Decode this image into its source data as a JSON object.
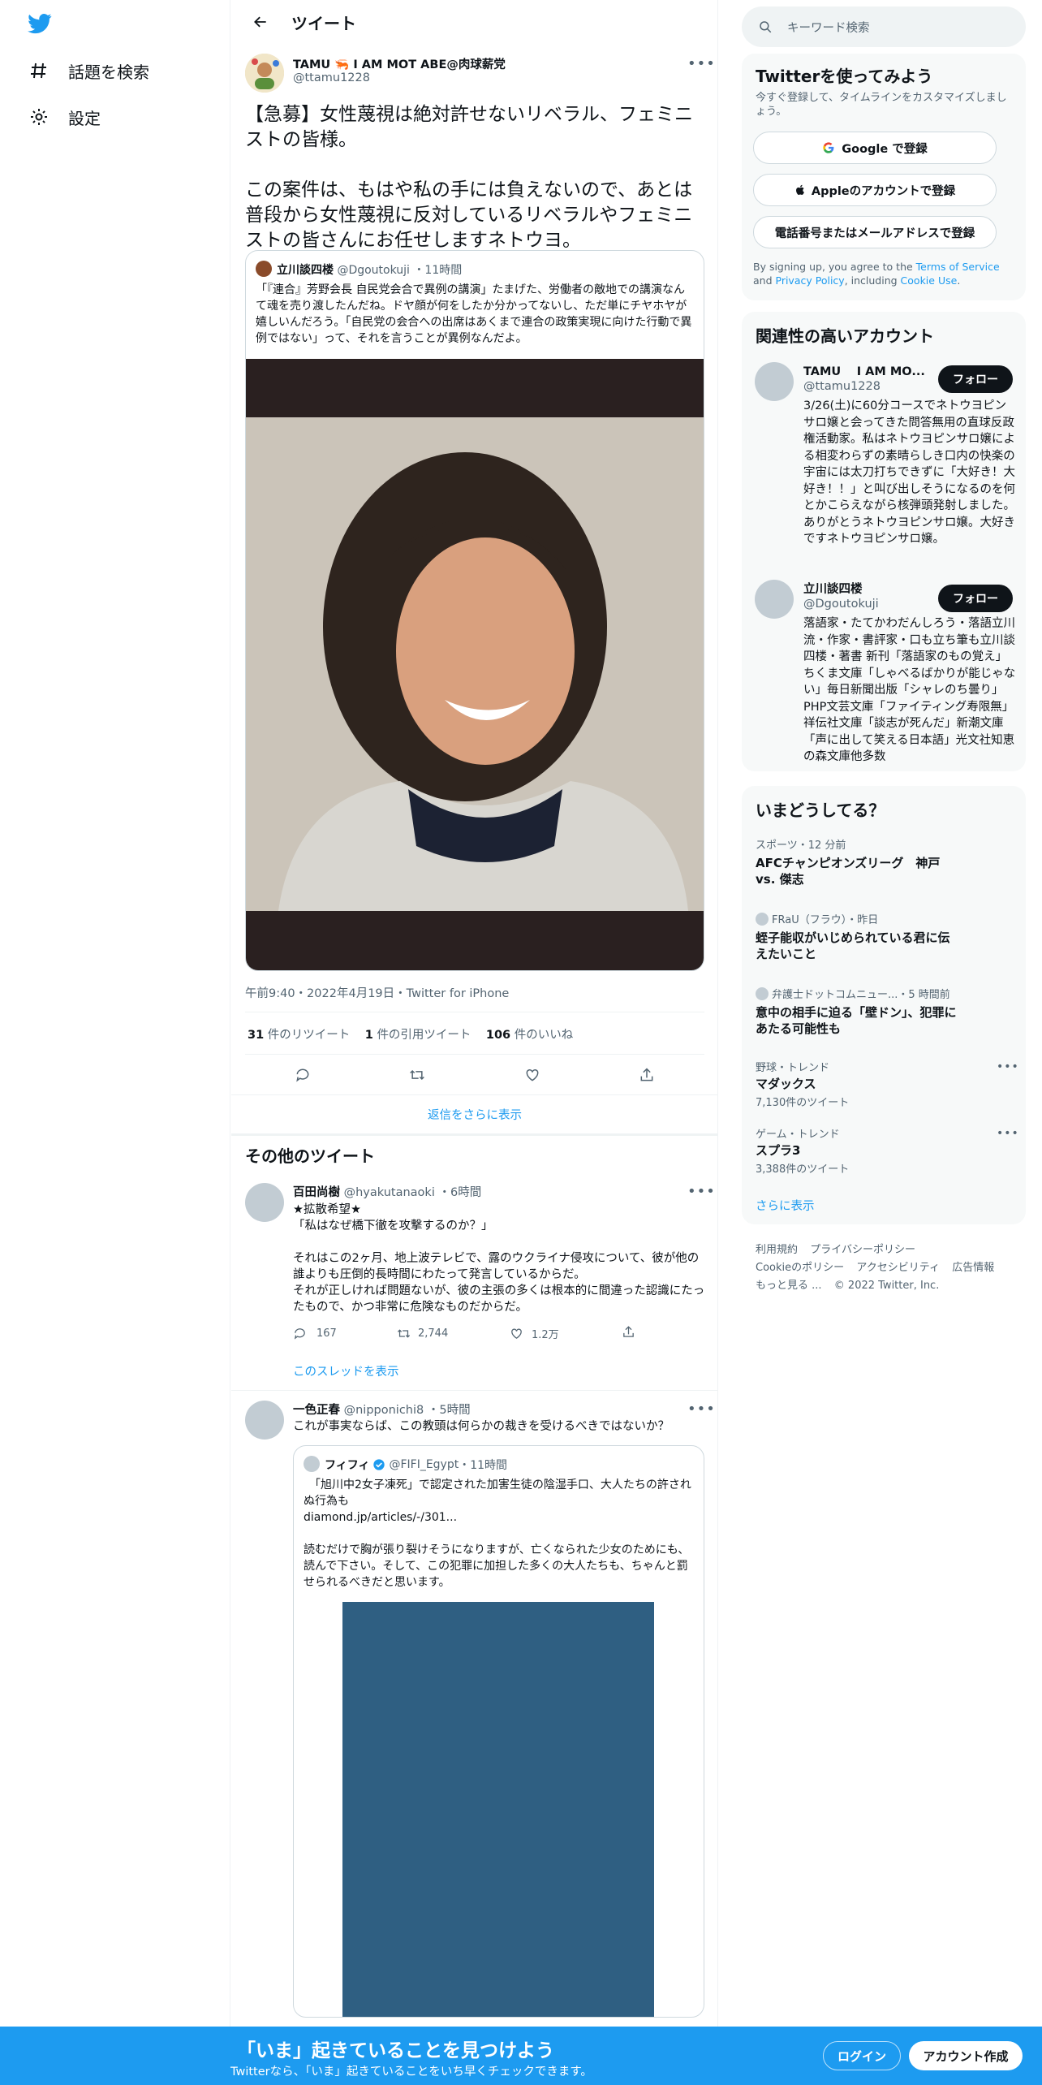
{
  "nav": {
    "logo": "twitter-bird",
    "items": [
      {
        "label": "話題を検索",
        "icon": "hashtag-icon"
      },
      {
        "label": "設定",
        "icon": "gear-icon"
      }
    ]
  },
  "header": {
    "title": "ツイート"
  },
  "tweet": {
    "name": "TAMU 🦐 I AM MOT ABE@肉球薪党",
    "handle": "@ttamu1228",
    "text": "【急募】女性蔑視は絶対許せないリベラル、フェミニストの皆様。\n\nこの案件は、もはや私の手には負えないので、あとは普段から女性蔑視に反対しているリベラルやフェミニストの皆さんにお任せしますネトウヨ。",
    "quote": {
      "name": "立川談四楼",
      "handle": "@Dgoutokuji",
      "time": "11時間",
      "text": "「『連合』芳野会長 自民党会合で異例の講演」たまげた、労働者の敵地での講演なんて魂を売り渡したんだね。ドヤ顔が何をしたか分かってないし、ただ単にチヤホヤが嬉しいんだろう。「自民党の会合への出席はあくまで連合の政策実現に向けた行動で異例ではない」って、それを言うことが異例なんだよ。"
    },
    "meta": "午前9:40・2022年4月19日・Twitter for iPhone",
    "stats": {
      "retweets_n": "31",
      "retweets_l": "件のリツイート",
      "quotes_n": "1",
      "quotes_l": "件の引用ツイート",
      "likes_n": "106",
      "likes_l": "件のいいね"
    },
    "show_more": "返信をさらに表示"
  },
  "other": {
    "heading": "その他のツイート",
    "t1": {
      "name": "百田尚樹",
      "handle": "@hyakutanaoki",
      "time": "6時間",
      "text": "★拡散希望★\n「私はなぜ橋下徹を攻撃するのか？」\n\nそれはこの2ヶ月、地上波テレビで、露のウクライナ侵攻について、彼が他の誰よりも圧倒的長時間にわたって発言しているからだ。\nそれが正しければ問題ないが、彼の主張の多くは根本的に間違った認識にたったもので、かつ非常に危険なものだからだ。",
      "replies": "167",
      "retweets": "2,744",
      "likes": "1.2万",
      "thread": "このスレッドを表示"
    },
    "t2": {
      "name": "一色正春",
      "handle": "@nipponichi8",
      "time": "5時間",
      "text": "これが事実ならば、この教頭は何らかの裁きを受けるべきではないか？",
      "quote": {
        "name": "フィフィ",
        "handle": "@FIFI_Egypt",
        "time": "11時間",
        "text": "　「旭川中2女子凍死」で認定された加害生徒の陰湿手口、大人たちの許されぬ行為も\ndiamond.jp/articles/-/301...\n\n読むだけで胸が張り裂けそうになりますが、亡くなられた少女のためにも、読んで下さい。そして、この犯罪に加担した多くの大人たちも、ちゃんと罰せられるべきだと思います。"
      }
    }
  },
  "sidebar": {
    "search_placeholder": "キーワード検索",
    "signup": {
      "title": "Twitterを使ってみよう",
      "sub": "今すぐ登録して、タイムラインをカスタマイズしましょう。",
      "google": "Google で登録",
      "apple": "Appleのアカウントで登録",
      "phone": "電話番号またはメールアドレスで登録",
      "terms_pre": "By signing up, you agree to the ",
      "terms": "Terms of Service",
      "and": " and ",
      "privacy": "Privacy Policy",
      "incl": ", including ",
      "cookie": "Cookie Use",
      "dot": "."
    },
    "related": {
      "title": "関連性の高いアカウント",
      "follow": "フォロー",
      "accounts": [
        {
          "name": "TAMU　 I AM MO...",
          "handle": "@ttamu1228",
          "desc": "3/26(土)に60分コースでネトウヨピンサロ嬢と会ってきた問答無用の直球反政権活動家。私はネトウヨピンサロ嬢による相変わらずの素晴らしき口内の快楽の宇宙には太刀打ちできずに「大好き！大好き！！」と叫び出しそうになるのを何とかこらえながら核弾頭発射しました。ありがとうネトウヨピンサロ嬢。大好きですネトウヨピンサロ嬢。"
        },
        {
          "name": "立川談四楼",
          "handle": "@Dgoutokuji",
          "desc": "落語家・たてかわだんしろう・落語立川流・作家・書評家・口も立ち筆も立川談四楼・著書 新刊「落語家のもの覚え」ちくま文庫「しゃべるばかりが能じゃない」毎日新聞出版「シャレのち曇り」PHP文芸文庫「ファイティング寿限無」祥伝社文庫「談志が死んだ」新潮文庫「声に出して笑える日本語」光文社知恵の森文庫他多数"
        }
      ]
    },
    "trends": {
      "title": "いまどうしてる？",
      "items": [
        {
          "cat": "スポーツ・12 分前",
          "title": "AFCチャンピオンズリーグ　神戸 vs. 傑志"
        },
        {
          "cat": "FRaU（フラウ）・昨日",
          "title": "蛭子能収がいじめられている君に伝えたいこと"
        },
        {
          "cat": "弁護士ドットコムニュー...・5 時間前",
          "title": "意中の相手に迫る「壁ドン」、犯罪にあたる可能性も"
        },
        {
          "cat": "野球・トレンド",
          "title": "マダックス",
          "count": "7,130件のツイート"
        },
        {
          "cat": "ゲーム・トレンド",
          "title": "スプラ3",
          "count": "3,388件のツイート"
        }
      ],
      "more": "さらに表示"
    },
    "footer": {
      "terms": "利用規約",
      "privacy": "プライバシーポリシー",
      "cookie": "Cookieのポリシー",
      "access": "アクセシビリティ",
      "ads": "広告情報",
      "more": "もっと見る ...",
      "copy": "© 2022 Twitter, Inc."
    }
  },
  "bottom": {
    "title": "「いま」起きていることを見つけよう",
    "sub": "Twitterなら、「いま」起きていることをいち早くチェックできます。",
    "login": "ログイン",
    "signup": "アカウント作成"
  },
  "colors": {
    "accent": "#1d9bf0",
    "text": "#0f1419",
    "muted": "#536471"
  }
}
